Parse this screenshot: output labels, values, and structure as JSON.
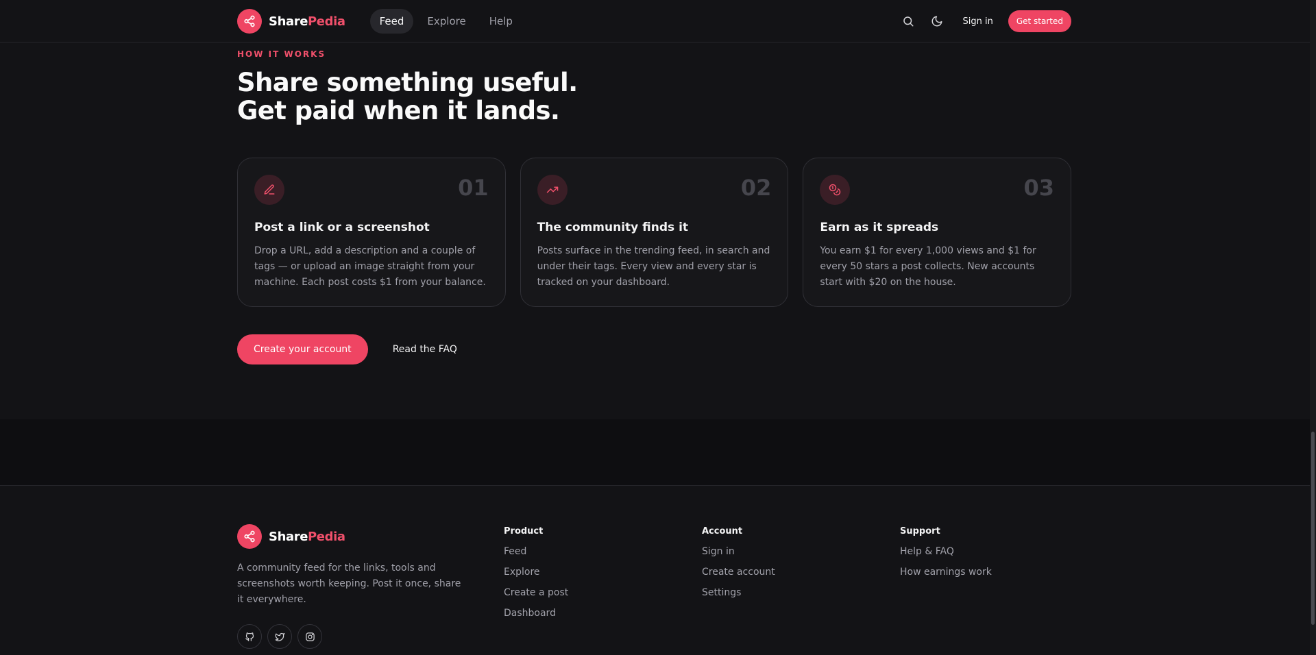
{
  "header": {
    "brand_a": "Share",
    "brand_b": "Pedia",
    "nav": [
      {
        "label": "Feed",
        "active": true
      },
      {
        "label": "Explore",
        "active": false
      },
      {
        "label": "Help",
        "active": false
      }
    ],
    "search_icon": "search-icon",
    "theme_icon": "moon-icon",
    "signin": "Sign in",
    "get_started": "Get started"
  },
  "how": {
    "eyebrow": "HOW IT WORKS",
    "headline_1": "Share something useful.",
    "headline_2": "Get paid when it lands.",
    "cards": [
      {
        "num": "01",
        "icon": "pencil-icon",
        "title": "Post a link or a screenshot",
        "body": "Drop a URL, add a description and a couple of tags — or upload an image straight from your machine. Each post costs $1 from your balance."
      },
      {
        "num": "02",
        "icon": "trending-up-icon",
        "title": "The community finds it",
        "body": "Posts surface in the trending feed, in search and under their tags. Every view and every star is tracked on your dashboard."
      },
      {
        "num": "03",
        "icon": "coins-icon",
        "title": "Earn as it spreads",
        "body": "You earn $1 for every 1,000 views and $1 for every 50 stars a post collects. New accounts start with $20 on the house."
      }
    ],
    "cta_primary": "Create your account",
    "cta_secondary": "Read the FAQ"
  },
  "footer": {
    "brand_a": "Share",
    "brand_b": "Pedia",
    "description": "A community feed for the links, tools and screenshots worth keeping. Post it once, share it everywhere.",
    "socials": [
      "github-icon",
      "twitter-icon",
      "instagram-icon"
    ],
    "columns": [
      {
        "title": "Product",
        "links": [
          "Feed",
          "Explore",
          "Create a post",
          "Dashboard"
        ]
      },
      {
        "title": "Account",
        "links": [
          "Sign in",
          "Create account",
          "Settings"
        ]
      },
      {
        "title": "Support",
        "links": [
          "Help & FAQ",
          "How earnings work"
        ]
      }
    ]
  },
  "colors": {
    "accent": "#ef4563",
    "background": "#131316",
    "band": "#0e0e11"
  }
}
